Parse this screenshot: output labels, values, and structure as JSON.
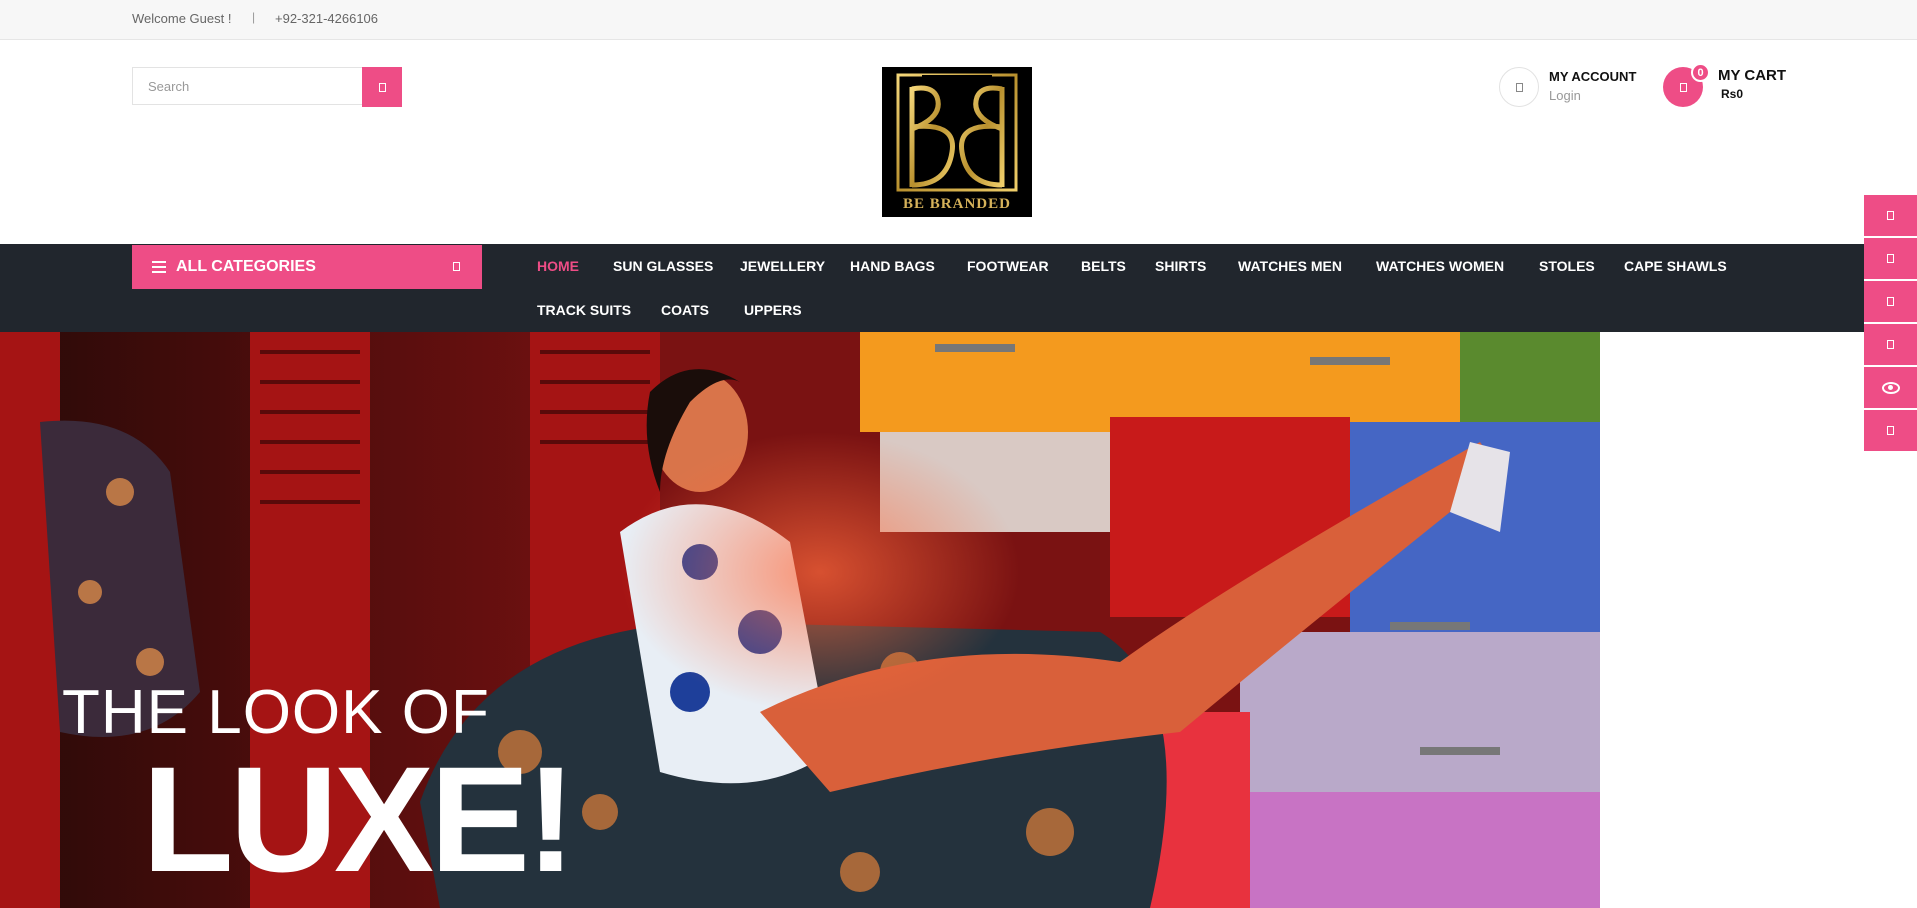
{
  "topbar": {
    "welcome": "Welcome Guest !",
    "separator": "|",
    "phone": "+92-321-4266106"
  },
  "header": {
    "search": {
      "placeholder": "Search",
      "value": ""
    },
    "logo_text": "BE BRANDED",
    "account": {
      "title": "MY ACCOUNT",
      "login": "Login"
    },
    "cart": {
      "count": "0",
      "title": "MY CART",
      "total": "Rs0"
    }
  },
  "nav": {
    "all_categories": "ALL CATEGORIES",
    "items": [
      "HOME",
      "SUN GLASSES",
      "JEWELLERY",
      "HAND BAGS",
      "FOOTWEAR",
      "BELTS",
      "SHIRTS",
      "WATCHES MEN",
      "WATCHES WOMEN",
      "STOLES",
      "CAPE SHAWLS",
      "TRACK SUITS",
      "COATS",
      "UPPERS"
    ],
    "active": "HOME"
  },
  "hero": {
    "line1": "THE LOOK OF",
    "line2": "LUXE!"
  },
  "sidetools": [
    "square-icon",
    "square-icon",
    "square-icon",
    "square-icon",
    "eye-icon",
    "square-icon"
  ],
  "colors": {
    "accent": "#ee4d86",
    "nav_bg": "#21262d",
    "topbar_bg": "#f7f7f7"
  }
}
